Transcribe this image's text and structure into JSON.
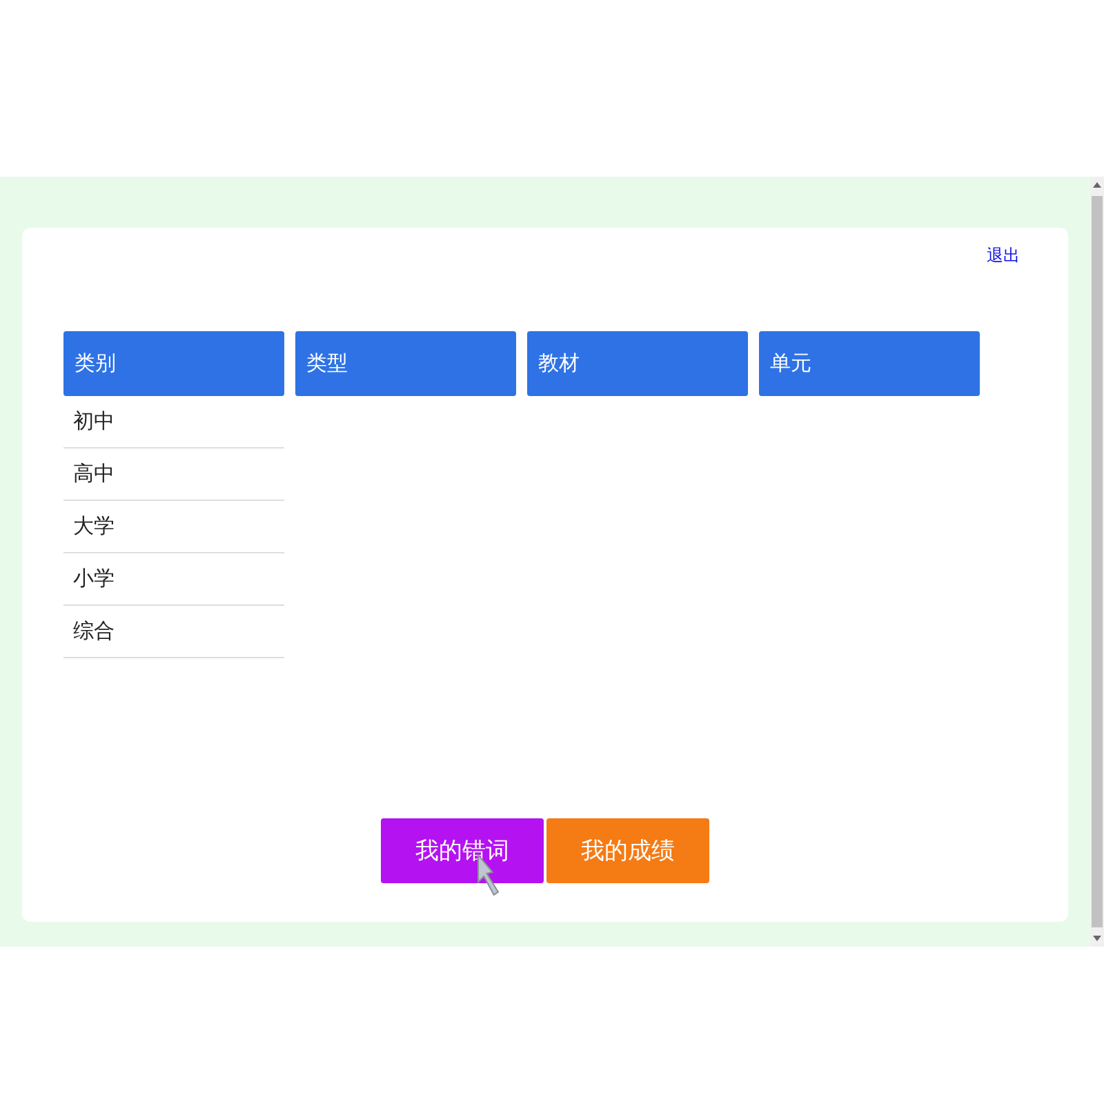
{
  "logout_link": "退出",
  "columns": [
    {
      "header": "类别",
      "items": [
        "初中",
        "高中",
        "大学",
        "小学",
        "综合"
      ]
    },
    {
      "header": "类型"
    },
    {
      "header": "教材"
    },
    {
      "header": "单元"
    }
  ],
  "buttons": [
    {
      "label": "我的错词",
      "color": "#b412f0"
    },
    {
      "label": "我的成绩",
      "color": "#f57b14"
    }
  ]
}
